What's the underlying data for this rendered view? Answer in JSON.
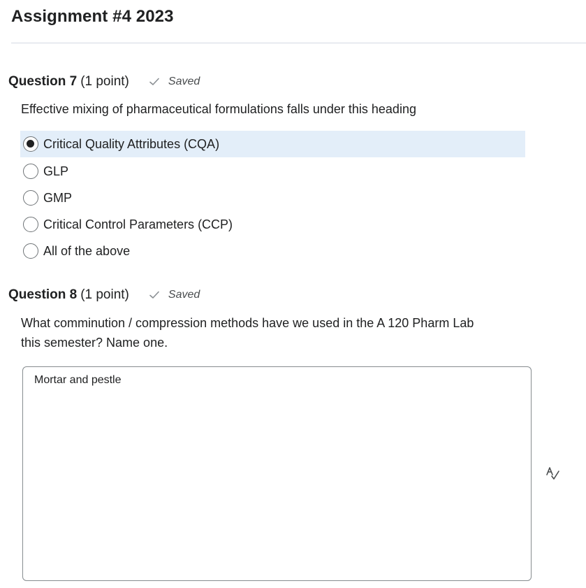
{
  "page": {
    "title": "Assignment #4 2023"
  },
  "questions": [
    {
      "number": "Question 7",
      "points": "(1 point)",
      "status": "Saved",
      "text": "Effective mixing of pharmaceutical formulations falls under this heading",
      "options": [
        {
          "label": "Critical Quality Attributes (CQA)",
          "selected": true
        },
        {
          "label": "GLP",
          "selected": false
        },
        {
          "label": "GMP",
          "selected": false
        },
        {
          "label": "Critical Control Parameters (CCP)",
          "selected": false
        },
        {
          "label": "All of the above",
          "selected": false
        }
      ]
    },
    {
      "number": "Question 8",
      "points": "(1 point)",
      "status": "Saved",
      "text_line1": "What comminution / compression methods have we used in the A 120 Pharm Lab",
      "text_line2": "this semester? Name one.",
      "answer": "Mortar and pestle"
    }
  ],
  "icons": {
    "saved": "check-icon",
    "spellcheck": "spellcheck-icon"
  },
  "colors": {
    "selected_bg": "#e3eef9",
    "divider": "#d3d9e3",
    "text": "#202122",
    "muted": "#494c4e"
  }
}
